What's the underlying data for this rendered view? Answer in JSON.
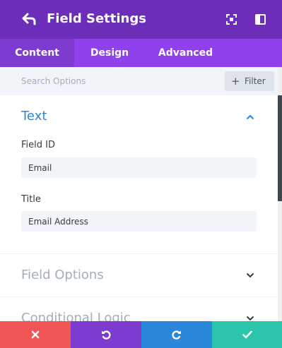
{
  "header": {
    "title": "Field Settings",
    "background_color": "#6c2eb9",
    "back_icon": "back-arrow-icon",
    "expand_icon": "expand-icon",
    "sidebar_icon": "sidebar-toggle-icon"
  },
  "tabs": [
    {
      "label": "Content",
      "active": true
    },
    {
      "label": "Design",
      "active": false
    },
    {
      "label": "Advanced",
      "active": false
    }
  ],
  "search": {
    "placeholder": "Search Options",
    "value": "",
    "filter_label": "Filter",
    "filter_icon": "plus-icon"
  },
  "sections": {
    "text": {
      "title": "Text",
      "expanded": true,
      "title_color": "#2b87da",
      "fields": [
        {
          "label": "Field ID",
          "value": "Email"
        },
        {
          "label": "Title",
          "value": "Email Address"
        }
      ]
    },
    "field_options": {
      "title": "Field Options",
      "expanded": false
    },
    "conditional_logic": {
      "title": "Conditional Logic",
      "expanded": false
    }
  },
  "footer": {
    "buttons": [
      {
        "name": "discard-button",
        "icon": "close-icon",
        "color": "#ef5555"
      },
      {
        "name": "undo-button",
        "icon": "undo-icon",
        "color": "#7e3bd0"
      },
      {
        "name": "redo-button",
        "icon": "redo-icon",
        "color": "#2b87da"
      },
      {
        "name": "save-button",
        "icon": "check-icon",
        "color": "#29c4a9"
      }
    ]
  }
}
